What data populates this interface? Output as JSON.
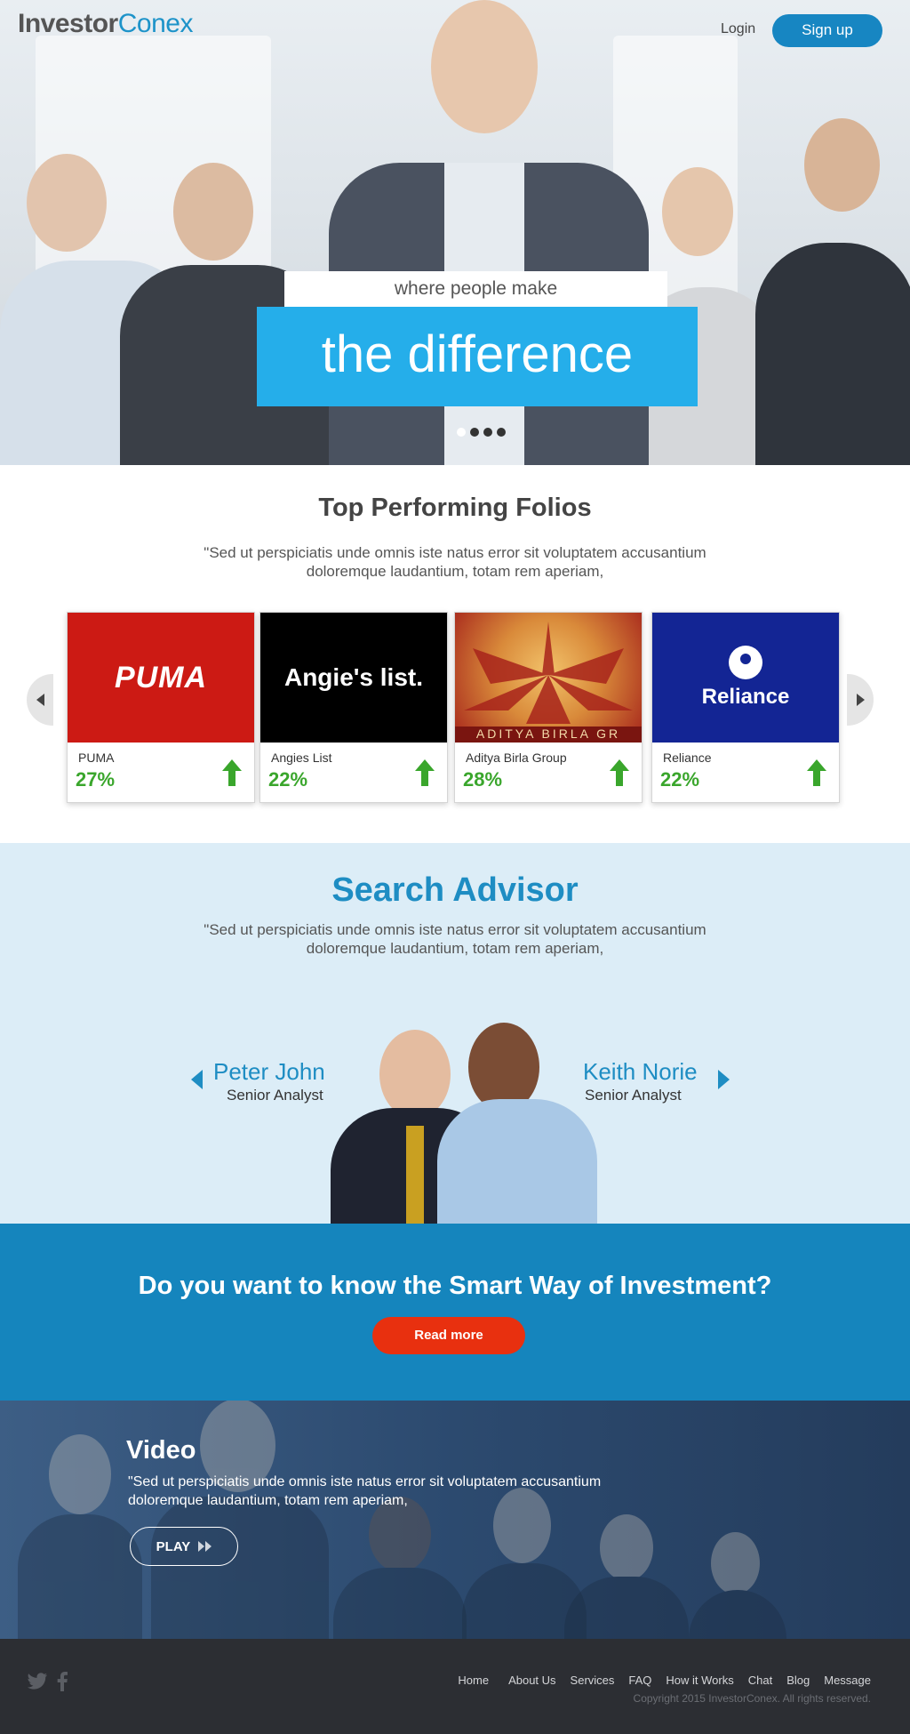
{
  "header": {
    "logo_part1": "Investor",
    "logo_part2": "Conex",
    "login_label": "Login",
    "signup_label": "Sign up"
  },
  "hero": {
    "tagline_small": "where people make",
    "tagline_large": "the difference",
    "slides_count": 4,
    "active_slide": 1
  },
  "folios": {
    "title": "Top Performing Folios",
    "description_line1": "\"Sed ut perspiciatis unde omnis iste natus error sit voluptatem accusantium",
    "description_line2": "doloremque laudantium, totam rem aperiam,",
    "cards": [
      {
        "name": "PUMA",
        "percent": "27%",
        "logo_text": "PUMA",
        "color": "#cc1a14"
      },
      {
        "name": "Angies List",
        "percent": "22%",
        "logo_text": "Angie's list.",
        "color": "#000000"
      },
      {
        "name": "Aditya Birla Group",
        "percent": "28%",
        "logo_text": "ADITYA BIRLA GR",
        "color": "#b8291f"
      },
      {
        "name": "Reliance",
        "percent": "22%",
        "logo_text": "Reliance",
        "color": "#132594"
      }
    ]
  },
  "advisor": {
    "title": "Search Advisor",
    "description_line1": "\"Sed ut perspiciatis unde omnis iste natus error sit voluptatem accusantium",
    "description_line2": "doloremque laudantium, totam rem aperiam,",
    "left_name": "Peter John",
    "left_role": "Senior Analyst",
    "right_name": "Keith Norie",
    "right_role": "Senior Analyst"
  },
  "cta": {
    "title": "Do you want to know the Smart Way of Investment?",
    "button_label": "Read more"
  },
  "video": {
    "title": "Video",
    "description_line1": "\"Sed ut perspiciatis unde omnis iste natus error sit voluptatem accusantium",
    "description_line2": "doloremque laudantium, totam rem aperiam,",
    "play_label": "PLAY"
  },
  "footer": {
    "nav": [
      "Home",
      "About Us",
      "Services",
      "FAQ",
      "How it Works",
      "Chat",
      "Blog",
      "Message"
    ],
    "copyright": "Copyright 2015 InvestorConex. All rights reserved.",
    "social_icons": [
      "twitter-icon",
      "facebook-icon"
    ]
  },
  "colors": {
    "brand_blue": "#1d93c9",
    "hero_tag_blue": "#25aeea",
    "cta_blue": "#1585bd",
    "read_more_red": "#e8300f",
    "growth_green": "#3aa62c",
    "footer_bg": "#2c2e33"
  }
}
